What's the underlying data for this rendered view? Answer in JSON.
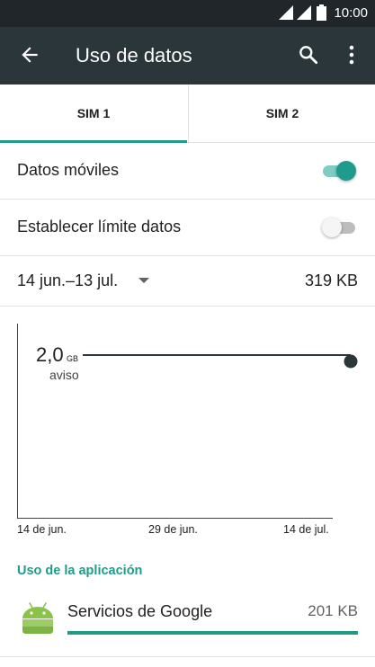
{
  "status_bar": {
    "time": "10:00"
  },
  "app_bar": {
    "title": "Uso de datos"
  },
  "tabs": [
    {
      "label": "SIM 1",
      "selected": true
    },
    {
      "label": "SIM 2",
      "selected": false
    }
  ],
  "settings": {
    "mobile_data": {
      "label": "Datos móviles",
      "enabled": true
    },
    "data_limit": {
      "label": "Establecer límite datos",
      "enabled": false
    },
    "cycle": {
      "range": "14 jun.–13 jul.",
      "usage": "319 KB"
    }
  },
  "usage_chart": {
    "warning_value": "2,0",
    "warning_unit": "GB",
    "warning_label": "aviso",
    "x_labels": [
      "14 de jun.",
      "29 de jun.",
      "14 de jul."
    ]
  },
  "app_usage": {
    "header": "Uso de la aplicación",
    "items": [
      {
        "name": "Servicios de Google",
        "size": "201 KB",
        "fraction": 1.0
      }
    ]
  },
  "colors": {
    "accent": "#1f9b8c",
    "app_bar": "#2b363b",
    "status_bar": "#20262a"
  }
}
